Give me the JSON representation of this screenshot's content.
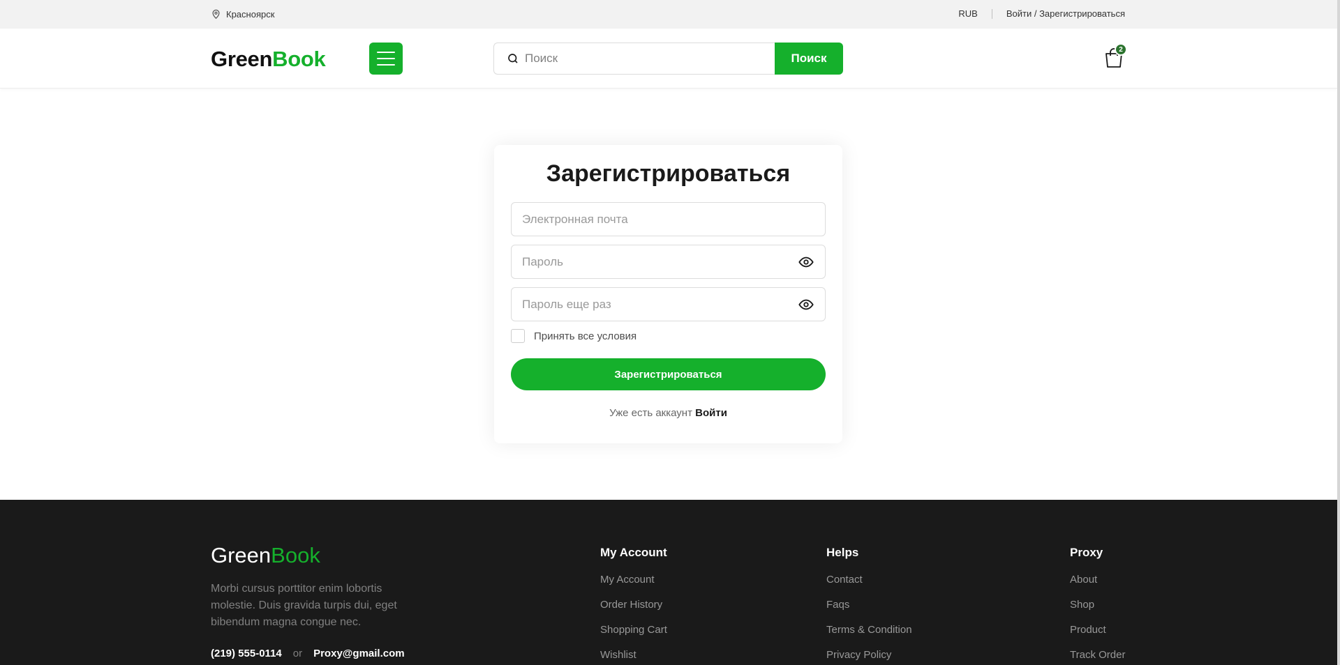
{
  "topbar": {
    "location": "Красноярск",
    "currency": "RUB",
    "auth": "Войти / Зарегистрироваться"
  },
  "header": {
    "logo_part1": "Green",
    "logo_part2": "Book",
    "search_placeholder": "Поиск",
    "search_button": "Поиск",
    "cart_count": "2"
  },
  "register": {
    "title": "Зарегистрироваться",
    "email_placeholder": "Электронная почта",
    "password_placeholder": "Пароль",
    "password_repeat_placeholder": "Пароль еще раз",
    "terms_label": "Принять все условия",
    "submit_label": "Зарегистрироваться",
    "have_account": "Уже есть аккаунт",
    "login_link": "Войти"
  },
  "footer": {
    "logo_part1": "Green",
    "logo_part2": "Book",
    "description": "Morbi cursus porttitor enim lobortis molestie. Duis gravida turpis dui, eget bibendum magna congue nec.",
    "phone": "(219) 555-0114",
    "or": "or",
    "email": "Proxy@gmail.com",
    "columns": [
      {
        "title": "My Account",
        "items": [
          "My Account",
          "Order History",
          "Shopping Cart",
          "Wishlist"
        ]
      },
      {
        "title": "Helps",
        "items": [
          "Contact",
          "Faqs",
          "Terms & Condition",
          "Privacy Policy"
        ]
      },
      {
        "title": "Proxy",
        "items": [
          "About",
          "Shop",
          "Product",
          "Track Order"
        ]
      }
    ]
  },
  "colors": {
    "accent": "#15b02c",
    "badge": "#2c742f",
    "footer_bg": "#1a1a1a",
    "topbar_bg": "#f2f2f2"
  },
  "icons": [
    "map-pin-icon",
    "menu-icon",
    "search-icon",
    "shopping-bag-icon",
    "eye-icon"
  ]
}
